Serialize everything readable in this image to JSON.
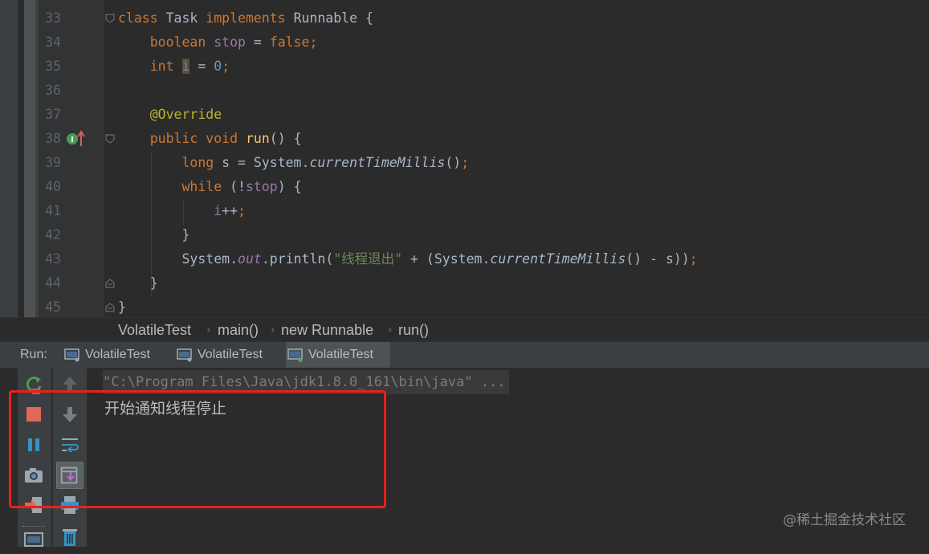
{
  "editor": {
    "lines": [
      {
        "num": "33",
        "tokens": [
          {
            "t": "class ",
            "c": "kw"
          },
          {
            "t": "Task "
          },
          {
            "t": "implements ",
            "c": "kw"
          },
          {
            "t": "Runnable {"
          }
        ]
      },
      {
        "num": "34",
        "tokens": [
          {
            "t": "    "
          },
          {
            "t": "boolean ",
            "c": "kw"
          },
          {
            "t": "stop",
            "c": "itpurple-plain"
          },
          {
            "t": " = "
          },
          {
            "t": "false",
            "c": "kw"
          },
          {
            "t": ";",
            "c": "kw"
          }
        ]
      },
      {
        "num": "35",
        "tokens": [
          {
            "t": "    "
          },
          {
            "t": "int ",
            "c": "kw"
          },
          {
            "t": "i",
            "c": "hl-purple"
          },
          {
            "t": " = "
          },
          {
            "t": "0",
            "c": "num"
          },
          {
            "t": ";",
            "c": "kw"
          }
        ]
      },
      {
        "num": "36",
        "tokens": []
      },
      {
        "num": "37",
        "tokens": [
          {
            "t": "    "
          },
          {
            "t": "@Override",
            "c": "an"
          }
        ]
      },
      {
        "num": "38",
        "tokens": [
          {
            "t": "    "
          },
          {
            "t": "public ",
            "c": "kw"
          },
          {
            "t": "void ",
            "c": "kw"
          },
          {
            "t": "run",
            "c": "fn"
          },
          {
            "t": "() {"
          }
        ]
      },
      {
        "num": "39",
        "tokens": [
          {
            "t": "        "
          },
          {
            "t": "long ",
            "c": "kw"
          },
          {
            "t": "s = System."
          },
          {
            "t": "currentTimeMillis",
            "c": "it"
          },
          {
            "t": "()"
          },
          {
            "t": ";",
            "c": "kw"
          }
        ]
      },
      {
        "num": "40",
        "tokens": [
          {
            "t": "        "
          },
          {
            "t": "while ",
            "c": "kw"
          },
          {
            "t": "(!"
          },
          {
            "t": "stop",
            "c": "purple"
          },
          {
            "t": ") {"
          }
        ]
      },
      {
        "num": "41",
        "tokens": [
          {
            "t": "            "
          },
          {
            "t": "i",
            "c": "purple"
          },
          {
            "t": "++"
          },
          {
            "t": ";",
            "c": "kw"
          }
        ]
      },
      {
        "num": "42",
        "tokens": [
          {
            "t": "        }"
          }
        ]
      },
      {
        "num": "43",
        "tokens": [
          {
            "t": "        "
          },
          {
            "t": "System."
          },
          {
            "t": "out",
            "c": "itpurple"
          },
          {
            "t": ".println("
          },
          {
            "t": "\"线程退出\"",
            "c": "st"
          },
          {
            "t": " + (System."
          },
          {
            "t": "currentTimeMillis",
            "c": "it"
          },
          {
            "t": "() - s))"
          },
          {
            "t": ";",
            "c": "kw"
          }
        ]
      },
      {
        "num": "44",
        "tokens": [
          {
            "t": "    }"
          }
        ]
      },
      {
        "num": "45",
        "tokens": [
          {
            "t": "}"
          }
        ]
      }
    ]
  },
  "breadcrumb": {
    "items": [
      "VolatileTest",
      "main()",
      "new Runnable",
      "run()"
    ],
    "separator": "›"
  },
  "run_panel": {
    "label": "Run:",
    "tabs": [
      "VolatileTest",
      "VolatileTest",
      "VolatileTest"
    ],
    "active_tab_index": 2
  },
  "console": {
    "command": "\"C:\\Program Files\\Java\\jdk1.8.0_161\\bin\\java\" ...",
    "output": "开始通知线程停止"
  },
  "watermark": "@稀土掘金技术社区",
  "colors": {
    "keyword": "#cc7832",
    "annotation": "#ffc66d",
    "string": "#6a8759",
    "field": "#9876aa",
    "annotation_box": "#e8211b"
  }
}
